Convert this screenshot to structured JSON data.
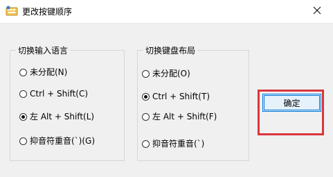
{
  "window": {
    "title": "更改按键顺序"
  },
  "input_language_group": {
    "legend": "切换输入语言",
    "options": [
      {
        "label": "未分配(N)",
        "checked": false
      },
      {
        "label": "Ctrl + Shift(C)",
        "checked": false
      },
      {
        "label": "左 Alt + Shift(L)",
        "checked": true
      },
      {
        "label": "抑音符重音(`)(G)",
        "checked": false
      }
    ]
  },
  "keyboard_layout_group": {
    "legend": "切换键盘布局",
    "options": [
      {
        "label": "未分配(O)",
        "checked": false
      },
      {
        "label": "Ctrl + Shift(T)",
        "checked": true
      },
      {
        "label": "左 Alt + Shift(F)",
        "checked": false
      },
      {
        "label": "抑音符重音(`)",
        "checked": false
      }
    ]
  },
  "buttons": {
    "ok_label": "确定"
  },
  "colors": {
    "highlight": "#d9363e",
    "button_border": "#0078d7",
    "button_bg": "#e5f1fb"
  },
  "icons": {
    "app": "keyboard-settings-icon",
    "close": "close-icon"
  }
}
